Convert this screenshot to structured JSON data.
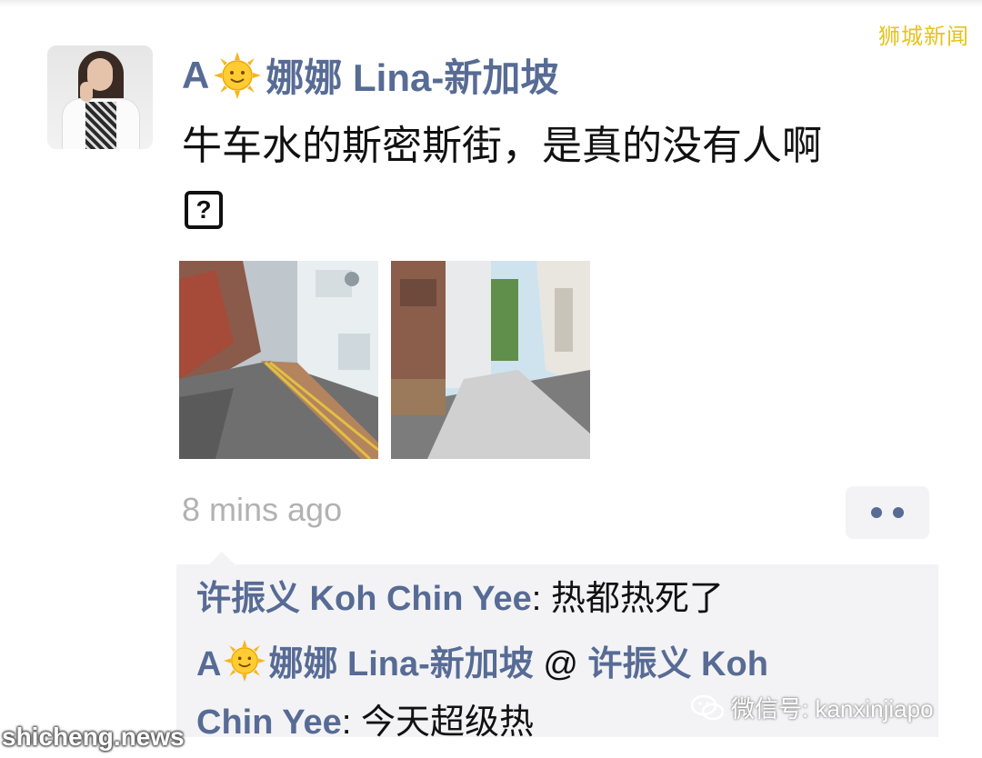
{
  "watermarks": {
    "top_right": "狮城新闻",
    "bottom_left": "shicheng.news",
    "wechat": "微信号: kanxinjiapo"
  },
  "post": {
    "author_prefix": "A",
    "author_suffix": "娜娜 Lina-新加坡",
    "text": "牛车水的斯密斯街，是真的没有人啊",
    "question_glyph": "?",
    "timestamp": "8 mins ago",
    "photos": [
      "street-photo-1",
      "street-photo-2"
    ]
  },
  "comments": [
    {
      "author": "许振义 Koh Chin Yee",
      "separator": ": ",
      "text": "热都热死了"
    },
    {
      "author_prefix": "A",
      "author_suffix": "娜娜 Lina-新加坡",
      "reply_marker": " @ ",
      "reply_to": "许振义 Koh",
      "reply_to_cont": "Chin Yee",
      "separator": ": ",
      "text": "今天超级热"
    }
  ],
  "icons": {
    "sun": "sun-emoji-icon",
    "more": "more-dots-icon",
    "wechat": "wechat-icon"
  },
  "colors": {
    "link": "#576b95",
    "timestamp": "#b2b2b2",
    "comment_bg": "#f3f3f5",
    "watermark_top": "#e8c21b"
  }
}
